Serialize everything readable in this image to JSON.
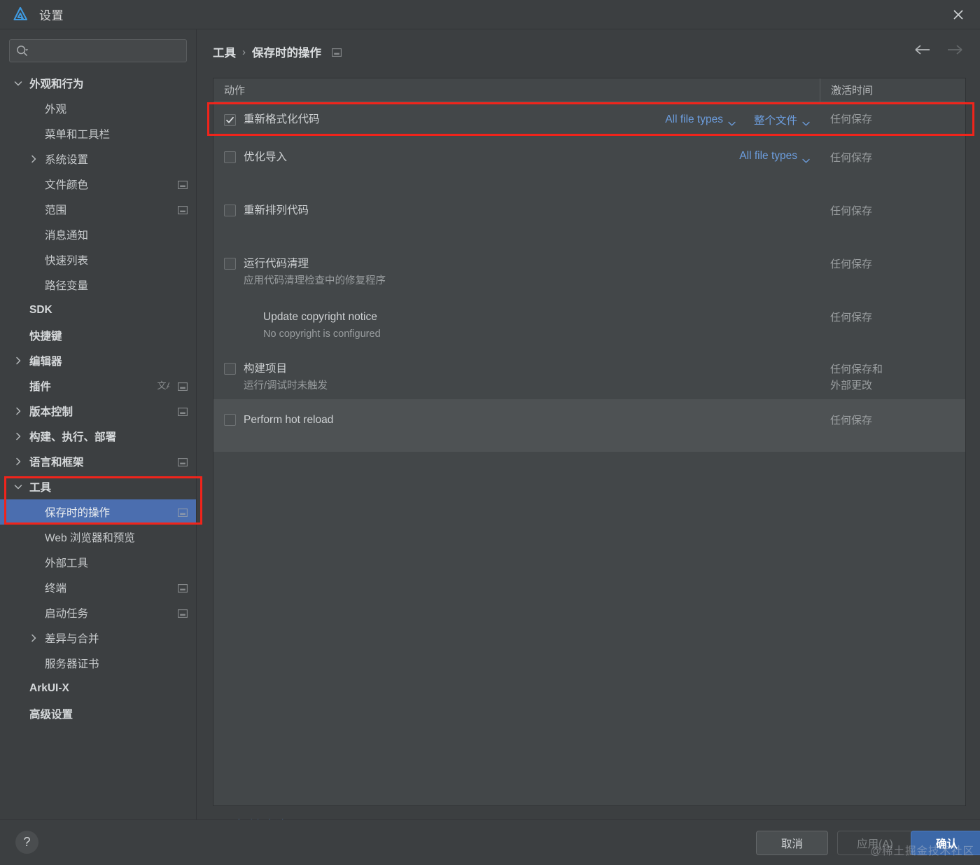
{
  "window": {
    "title": "设置",
    "logo_icon": "app-logo-icon",
    "close_icon": "close-icon"
  },
  "search": {
    "placeholder": "",
    "value": "",
    "icon": "search-icon"
  },
  "sidebar": {
    "items": [
      {
        "label": "外观和行为",
        "level": 0,
        "bold": true,
        "arrow": "chevron-down",
        "cfg": false,
        "translate": false,
        "selected": false,
        "name": "sidebar-item-appearance-behavior"
      },
      {
        "label": "外观",
        "level": 1,
        "bold": false,
        "arrow": "none",
        "cfg": false,
        "translate": false,
        "selected": false,
        "name": "sidebar-item-appearance"
      },
      {
        "label": "菜单和工具栏",
        "level": 1,
        "bold": false,
        "arrow": "none",
        "cfg": false,
        "translate": false,
        "selected": false,
        "name": "sidebar-item-menus-toolbars"
      },
      {
        "label": "系统设置",
        "level": 1,
        "bold": false,
        "arrow": "chevron-right",
        "cfg": false,
        "translate": false,
        "selected": false,
        "name": "sidebar-item-system-settings"
      },
      {
        "label": "文件颜色",
        "level": 1,
        "bold": false,
        "arrow": "none",
        "cfg": true,
        "translate": false,
        "selected": false,
        "name": "sidebar-item-file-colors"
      },
      {
        "label": "范围",
        "level": 1,
        "bold": false,
        "arrow": "none",
        "cfg": true,
        "translate": false,
        "selected": false,
        "name": "sidebar-item-scopes"
      },
      {
        "label": "消息通知",
        "level": 1,
        "bold": false,
        "arrow": "none",
        "cfg": false,
        "translate": false,
        "selected": false,
        "name": "sidebar-item-notifications"
      },
      {
        "label": "快速列表",
        "level": 1,
        "bold": false,
        "arrow": "none",
        "cfg": false,
        "translate": false,
        "selected": false,
        "name": "sidebar-item-quick-lists"
      },
      {
        "label": "路径变量",
        "level": 1,
        "bold": false,
        "arrow": "none",
        "cfg": false,
        "translate": false,
        "selected": false,
        "name": "sidebar-item-path-variables"
      },
      {
        "label": "SDK",
        "level": 0,
        "bold": true,
        "arrow": "none",
        "cfg": false,
        "translate": false,
        "selected": false,
        "name": "sidebar-item-sdk"
      },
      {
        "label": "快捷键",
        "level": 0,
        "bold": true,
        "arrow": "none",
        "cfg": false,
        "translate": false,
        "selected": false,
        "name": "sidebar-item-keymap"
      },
      {
        "label": "编辑器",
        "level": 0,
        "bold": true,
        "arrow": "chevron-right",
        "cfg": false,
        "translate": false,
        "selected": false,
        "name": "sidebar-item-editor"
      },
      {
        "label": "插件",
        "level": 0,
        "bold": true,
        "arrow": "none",
        "cfg": true,
        "translate": true,
        "selected": false,
        "name": "sidebar-item-plugins"
      },
      {
        "label": "版本控制",
        "level": 0,
        "bold": true,
        "arrow": "chevron-right",
        "cfg": true,
        "translate": false,
        "selected": false,
        "name": "sidebar-item-version-control"
      },
      {
        "label": "构建、执行、部署",
        "level": 0,
        "bold": true,
        "arrow": "chevron-right",
        "cfg": false,
        "translate": false,
        "selected": false,
        "name": "sidebar-item-build-execution-deployment"
      },
      {
        "label": "语言和框架",
        "level": 0,
        "bold": true,
        "arrow": "chevron-right",
        "cfg": true,
        "translate": false,
        "selected": false,
        "name": "sidebar-item-languages-frameworks"
      },
      {
        "label": "工具",
        "level": 0,
        "bold": true,
        "arrow": "chevron-down",
        "cfg": false,
        "translate": false,
        "selected": false,
        "name": "sidebar-item-tools"
      },
      {
        "label": "保存时的操作",
        "level": 1,
        "bold": false,
        "arrow": "none",
        "cfg": true,
        "translate": false,
        "selected": true,
        "name": "sidebar-item-actions-on-save"
      },
      {
        "label": "Web 浏览器和预览",
        "level": 1,
        "bold": false,
        "arrow": "none",
        "cfg": false,
        "translate": false,
        "selected": false,
        "name": "sidebar-item-web-browsers-preview"
      },
      {
        "label": "外部工具",
        "level": 1,
        "bold": false,
        "arrow": "none",
        "cfg": false,
        "translate": false,
        "selected": false,
        "name": "sidebar-item-external-tools"
      },
      {
        "label": "终端",
        "level": 1,
        "bold": false,
        "arrow": "none",
        "cfg": true,
        "translate": false,
        "selected": false,
        "name": "sidebar-item-terminal"
      },
      {
        "label": "启动任务",
        "level": 1,
        "bold": false,
        "arrow": "none",
        "cfg": true,
        "translate": false,
        "selected": false,
        "name": "sidebar-item-startup-tasks"
      },
      {
        "label": "差异与合并",
        "level": 1,
        "bold": false,
        "arrow": "chevron-right",
        "cfg": false,
        "translate": false,
        "selected": false,
        "name": "sidebar-item-diff-merge"
      },
      {
        "label": "服务器证书",
        "level": 1,
        "bold": false,
        "arrow": "none",
        "cfg": false,
        "translate": false,
        "selected": false,
        "name": "sidebar-item-server-certificates"
      },
      {
        "label": "ArkUI-X",
        "level": 0,
        "bold": true,
        "arrow": "none",
        "cfg": false,
        "translate": false,
        "selected": false,
        "name": "sidebar-item-arkui-x"
      },
      {
        "label": "高级设置",
        "level": 0,
        "bold": true,
        "arrow": "none",
        "cfg": false,
        "translate": false,
        "selected": false,
        "name": "sidebar-item-advanced-settings"
      }
    ]
  },
  "breadcrumb": {
    "parent": "工具",
    "separator": "›",
    "current": "保存时的操作",
    "cfg_icon": "settings-box-icon"
  },
  "nav": {
    "back_icon": "arrow-left-icon",
    "forward_icon": "arrow-right-icon"
  },
  "table": {
    "headers": {
      "action": "动作",
      "activation": "激活时间"
    },
    "rows": [
      {
        "title": "重新格式化代码",
        "subtitle": "",
        "checkbox": "checked",
        "has_checkbox": true,
        "dropdowns": [
          {
            "label": "All file types",
            "name": "file-types-dropdown"
          },
          {
            "label": "整个文件",
            "name": "scope-dropdown"
          }
        ],
        "activation": "任何保存",
        "highlighted": false,
        "name": "row-reformat-code"
      },
      {
        "title": "优化导入",
        "subtitle": "",
        "checkbox": "unchecked",
        "has_checkbox": true,
        "dropdowns": [
          {
            "label": "All file types",
            "name": "file-types-dropdown"
          }
        ],
        "activation": "任何保存",
        "highlighted": false,
        "name": "row-optimize-imports"
      },
      {
        "title": "重新排列代码",
        "subtitle": "",
        "checkbox": "unchecked",
        "has_checkbox": true,
        "dropdowns": [],
        "activation": "任何保存",
        "highlighted": false,
        "name": "row-rearrange-code"
      },
      {
        "title": "运行代码清理",
        "subtitle": "应用代码清理检查中的修复程序",
        "checkbox": "unchecked",
        "has_checkbox": true,
        "dropdowns": [],
        "activation": "任何保存",
        "highlighted": false,
        "name": "row-run-code-cleanup"
      },
      {
        "title": "Update copyright notice",
        "subtitle": "No copyright is configured",
        "checkbox": "none",
        "has_checkbox": false,
        "dropdowns": [],
        "activation": "任何保存",
        "highlighted": false,
        "name": "row-update-copyright-notice"
      },
      {
        "title": "构建项目",
        "subtitle": "运行/调试时未触发",
        "checkbox": "unchecked",
        "has_checkbox": true,
        "dropdowns": [],
        "activation": "任何保存和\n外部更改",
        "highlighted": false,
        "name": "row-build-project"
      },
      {
        "title": "Perform hot reload",
        "subtitle": "",
        "checkbox": "unchecked",
        "has_checkbox": true,
        "dropdowns": [],
        "activation": "任何保存",
        "highlighted": true,
        "name": "row-perform-hot-reload"
      }
    ]
  },
  "footer": {
    "config_link": "配置自动保存选项...",
    "help_label": "?",
    "cancel_label": "取消",
    "apply_label": "应用(A)",
    "ok_label": "确认"
  },
  "watermark": "@稀土掘金技术社区",
  "colors": {
    "accent_blue": "#4b6eaf",
    "link_blue": "#5a91d4",
    "dropdown_blue": "#6c9ddd",
    "highlight_red": "#f0241b",
    "panel_bg": "#3c3f41",
    "table_bg": "#434749",
    "row_highlight": "#4e5254",
    "ok_button": "#3c68a8"
  }
}
